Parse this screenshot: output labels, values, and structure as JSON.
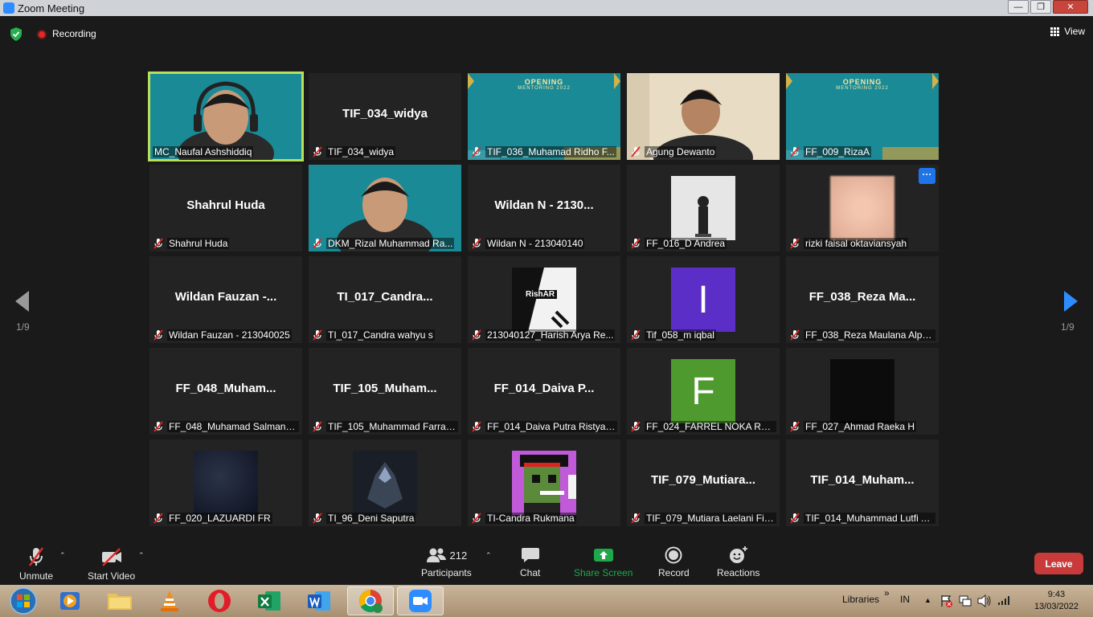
{
  "window": {
    "title": "Zoom Meeting",
    "min": "—",
    "max": "❐",
    "close": "✕"
  },
  "topbar": {
    "recording": "Recording",
    "view": "View"
  },
  "pagination": {
    "left": "1/9",
    "right": "1/9"
  },
  "tiles": [
    {
      "name": "MC_Naufal Ashshiddiq",
      "kind": "teal-video",
      "active": true,
      "muted": false
    },
    {
      "name": "TIF_034_widya",
      "big": "TIF_034_widya",
      "muted": true
    },
    {
      "name": "TIF_036_Muhamad Ridho F...",
      "kind": "teal",
      "banner": "OPENING",
      "banner2": "MENTORING 2022",
      "muted": true
    },
    {
      "name": "Agung Dewanto",
      "kind": "video-beige",
      "muted": true
    },
    {
      "name": "FF_009_RizaA",
      "kind": "teal",
      "banner": "OPENING",
      "banner2": "MENTORING 2022",
      "muted": true
    },
    {
      "name": "Shahrul Huda",
      "big": "Shahrul Huda",
      "muted": true
    },
    {
      "name": "DKM_Rizal Muhammad Ra...",
      "kind": "teal-video2",
      "muted": true
    },
    {
      "name": "Wildan N - 213040140",
      "big": "Wildan N - 2130...",
      "muted": true
    },
    {
      "name": "FF_016_D Andrea",
      "kind": "avatar-photo",
      "muted": true
    },
    {
      "name": "rizki faisal oktaviansyah",
      "kind": "avatar-blur",
      "more": "···",
      "muted": true
    },
    {
      "name": "Wildan Fauzan - 213040025",
      "big": "Wildan Fauzan -...",
      "muted": true
    },
    {
      "name": "TI_017_Candra wahyu s",
      "big": "TI_017_Candra...",
      "muted": true
    },
    {
      "name": "213040127_Harish Arya Re...",
      "kind": "avatar-rishar",
      "avatar_text": "RishAR",
      "muted": true
    },
    {
      "name": "Tif_058_m iqbal",
      "kind": "avatar-letter",
      "letter": "I",
      "color": "#5b2fc7",
      "muted": true
    },
    {
      "name": "FF_038_Reza Maulana Alpia...",
      "big": "FF_038_Reza Ma...",
      "muted": true
    },
    {
      "name": "FF_048_Muhamad Salman F...",
      "big": "FF_048_Muham...",
      "muted": true
    },
    {
      "name": "TIF_105_Muhammad Farras...",
      "big": "TIF_105_Muham...",
      "muted": true
    },
    {
      "name": "FF_014_Daiva Putra Ristyana",
      "big": "FF_014_Daiva P...",
      "muted": true
    },
    {
      "name": "FF_024_FARREL NOKA RADI...",
      "kind": "avatar-letter",
      "letter": "F",
      "color": "#4e9a2e",
      "muted": true
    },
    {
      "name": "FF_027_Ahmad Raeka H",
      "kind": "avatar-black",
      "muted": true
    },
    {
      "name": "FF_020_LAZUARDI FR",
      "kind": "avatar-space",
      "muted": true
    },
    {
      "name": "TI_96_Deni Saputra",
      "kind": "avatar-dark",
      "muted": true
    },
    {
      "name": "TI-Candra Rukmana",
      "kind": "avatar-pixel",
      "muted": true
    },
    {
      "name": "TIF_079_Mutiara Laelani Fir...",
      "big": "TIF_079_Mutiara...",
      "muted": true
    },
    {
      "name": "TIF_014_Muhammad Lutfi A...",
      "big": "TIF_014_Muham...",
      "muted": true
    }
  ],
  "controls": {
    "unmute": "Unmute",
    "start_video": "Start Video",
    "participants": "Participants",
    "participants_count": "212",
    "chat": "Chat",
    "share_screen": "Share Screen",
    "record": "Record",
    "reactions": "Reactions",
    "leave": "Leave"
  },
  "taskbar": {
    "libraries": "Libraries",
    "chevron": "»",
    "lang": "IN",
    "time": "9:43",
    "date": "13/03/2022"
  },
  "colors": {
    "accent_green": "#1fa84a",
    "leave_red": "#c93a3a",
    "active_speaker": "#b9e05a",
    "teal_bg": "#1a8a96"
  }
}
